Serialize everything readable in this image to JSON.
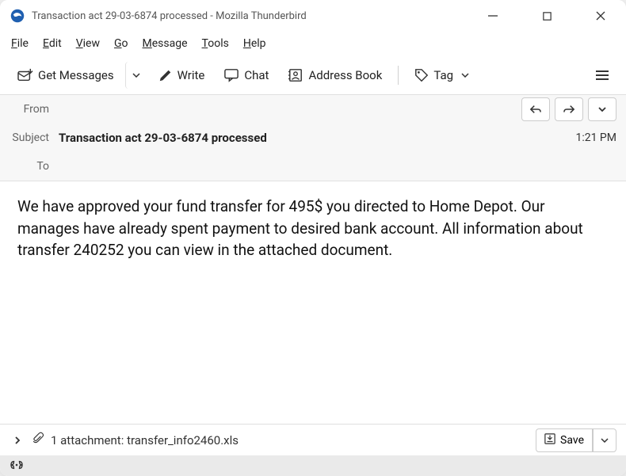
{
  "window": {
    "title": "Transaction act 29-03-6874 processed - Mozilla Thunderbird"
  },
  "menubar": {
    "file": "File",
    "edit": "Edit",
    "view": "View",
    "go": "Go",
    "message": "Message",
    "tools": "Tools",
    "help": "Help"
  },
  "toolbar": {
    "getmessages": "Get Messages",
    "write": "Write",
    "chat": "Chat",
    "addressbook": "Address Book",
    "tag": "Tag"
  },
  "headers": {
    "from_label": "From",
    "from_value": "",
    "subject_label": "Subject",
    "subject_value": "Transaction act 29-03-6874 processed",
    "to_label": "To",
    "to_value": "",
    "time": "1:21 PM"
  },
  "body": " We have approved your fund transfer for 495$ you directed to Home Depot. Our manages have already spent payment to desired bank account. All information about transfer 240252 you can view in the attached document.",
  "attachment": {
    "count_text": "1 attachment:",
    "filename": "transfer_info2460.xls",
    "save": "Save"
  }
}
